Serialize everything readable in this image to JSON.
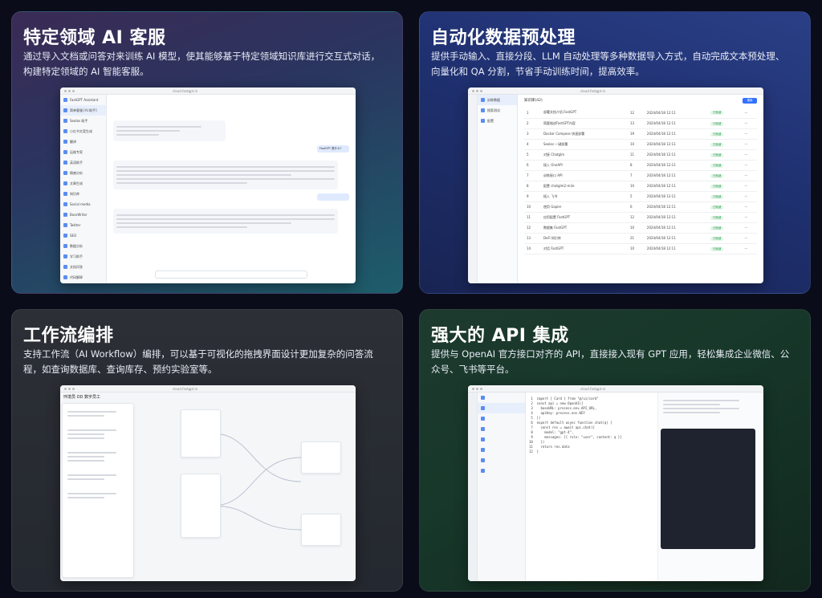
{
  "cards": [
    {
      "title": "特定领域 AI 客服",
      "desc": "通过导入文档或问答对来训练 AI 模型，使其能够基于特定领域知识库进行交互式对话，构建特定领域的 AI 智能客服。"
    },
    {
      "title": "自动化数据预处理",
      "desc": "提供手动输入、直接分段、LLM 自动处理等多种数据导入方式，自动完成文本预处理、向量化和 QA 分割，节省手动训练时间，提高效率。"
    },
    {
      "title": "工作流编排",
      "desc": "支持工作流（AI Workflow）编排，可以基于可视化的拖拽界面设计更加复杂的问答流程，如查询数据库、查询库存、预约实验室等。"
    },
    {
      "title": "强大的 API 集成",
      "desc": "提供与 OpenAI 官方接口对齐的 API，直接接入现有 GPT 应用，轻松集成企业微信、公众号、飞书等平台。"
    }
  ],
  "shot1": {
    "sidebar": [
      "FastGPT Assistant",
      "简单客服 [AI 助手]",
      "Sealos 助手",
      "小红书文案生成",
      "翻译",
      "运维专家",
      "英语助手",
      "情感分析",
      "文章生成",
      "知识库",
      "Social media",
      "BossWriter",
      "Twitter",
      "SEO",
      "数据分析",
      "学习助手",
      "文档问答",
      "代码解释"
    ],
    "user_msg": "FastGPT 是什么?"
  },
  "shot2": {
    "breadcrumb": "知识库(42)",
    "search_btn": "搜索",
    "rows": [
      {
        "name": "部署文档介绍.FastGPT",
        "count": "12",
        "date": "2024/04/18 12:11",
        "status": "已就绪"
      },
      {
        "name": "简要描述FastGPT内容",
        "count": "13",
        "date": "2024/04/18 12:11",
        "status": "已就绪"
      },
      {
        "name": "Docker Compose 快速部署",
        "count": "19",
        "date": "2024/04/18 12:11",
        "status": "已就绪"
      },
      {
        "name": "Sealos 一键部署",
        "count": "10",
        "date": "2024/04/18 12:11",
        "status": "已就绪"
      },
      {
        "name": "对接 Chatglm",
        "count": "11",
        "date": "2024/04/18 12:11",
        "status": "已就绪"
      },
      {
        "name": "接入 OneAPI",
        "count": "8",
        "date": "2024/04/18 12:11",
        "status": "已就绪"
      },
      {
        "name": "训练接口 API",
        "count": "7",
        "date": "2024/04/18 12:11",
        "status": "已就绪"
      },
      {
        "name": "配置 chatglm2-m3e",
        "count": "10",
        "date": "2024/04/18 12:11",
        "status": "已就绪"
      },
      {
        "name": "插入 飞书",
        "count": "5",
        "date": "2024/04/18 12:11",
        "status": "已就绪"
      },
      {
        "name": "使用 Gapier",
        "count": "6",
        "date": "2024/04/18 12:11",
        "status": "已就绪"
      },
      {
        "name": "应用配置 FastGPT",
        "count": "12",
        "date": "2024/04/18 12:11",
        "status": "已就绪"
      },
      {
        "name": "数据集 FastGPT",
        "count": "10",
        "date": "2024/04/18 12:11",
        "status": "已就绪"
      },
      {
        "name": "DeFi 知识库",
        "count": "21",
        "date": "2024/04/18 12:11",
        "status": "已就绪"
      },
      {
        "name": "对话 FastGPT",
        "count": "10",
        "date": "2024/04/18 12:11",
        "status": "已就绪"
      }
    ]
  },
  "shot3": {
    "title": "环境员 OD 数字员工"
  },
  "shot4": {
    "code_lines": [
      "import { Card } from \"@/ui/card\"",
      "const api = new OpenAI({",
      "  baseURL: process.env.API_URL,",
      "  apiKey: process.env.KEY",
      "})",
      "export default async function chat(q) {",
      "  const res = await api.chat({",
      "    model: \"gpt-4\",",
      "    messages: [{ role: \"user\", content: q }]",
      "  })",
      "  return res.data",
      "}"
    ]
  }
}
